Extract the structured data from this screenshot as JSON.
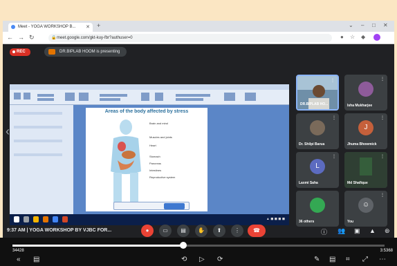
{
  "browser": {
    "tab_title": "Meet - YOGA WORKSHOP B...",
    "url": "meet.google.com/gkt-kuy-fbr?authuser=0"
  },
  "meeting": {
    "rec_label": "REC",
    "presenting_label": "DR.BIPLAB HOOM is presenting",
    "time_title": "9:37 AM  |  YOGA WORKSHOP BY VJBC FOR...",
    "slide": {
      "title": "Areas of the body affected by stress",
      "labels": [
        "Brain and mind",
        "Muscles and joints",
        "Heart",
        "Stomach",
        "Pancreas",
        "Intestines",
        "Reproductive system"
      ]
    },
    "participants": [
      {
        "name": "DR.BIPLAB HO...",
        "type": "video",
        "color": "#1a73e8"
      },
      {
        "name": "Isha Mukharjee",
        "type": "photo",
        "color": "#8e5b9a"
      },
      {
        "name": "Dr. Shilpi Barua",
        "type": "photo",
        "color": "#7a6a5a"
      },
      {
        "name": "Jhuma Bhowmick",
        "type": "letter",
        "letter": "J",
        "color": "#c5603b"
      },
      {
        "name": "Laxmi Saha",
        "type": "letter",
        "letter": "L",
        "color": "#5c6bc0"
      },
      {
        "name": "Md Shafique",
        "type": "photo",
        "color": "#355e3b"
      },
      {
        "name": "36 others",
        "type": "group",
        "color": "#34a853"
      },
      {
        "name": "You",
        "type": "self",
        "color": "#5f6368"
      }
    ]
  },
  "player": {
    "current_time": "34428",
    "total_time": "3:5368",
    "progress": 0.46
  }
}
